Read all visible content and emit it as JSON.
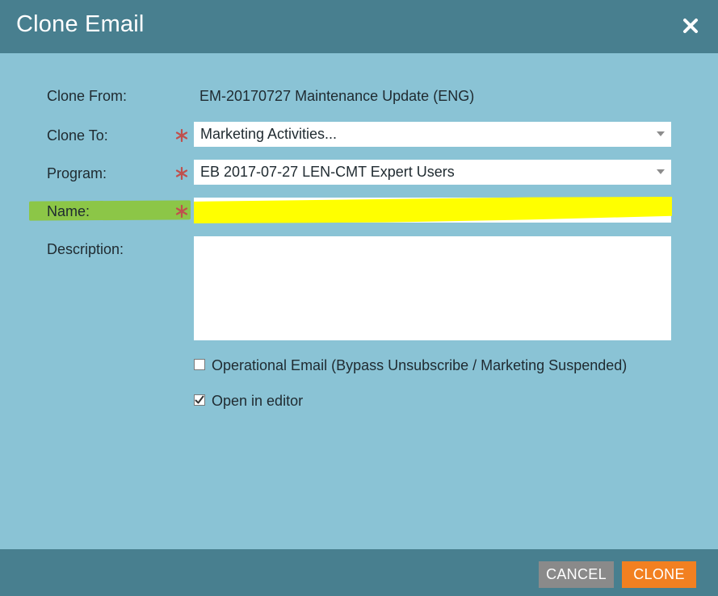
{
  "dialog": {
    "title": "Clone Email",
    "close_icon": "close-icon"
  },
  "form": {
    "clone_from": {
      "label": "Clone From:",
      "value": "EM-20170727 Maintenance Update (ENG)"
    },
    "clone_to": {
      "label": "Clone To:",
      "value": "Marketing Activities...",
      "required": true
    },
    "program": {
      "label": "Program:",
      "value": "EB 2017-07-27 LEN-CMT Expert Users",
      "required": true
    },
    "name": {
      "label": "Name:",
      "value": "",
      "required": true
    },
    "description": {
      "label": "Description:",
      "value": ""
    },
    "operational_email": {
      "label": "Operational Email (Bypass Unsubscribe / Marketing Suspended)",
      "checked": false
    },
    "open_in_editor": {
      "label": "Open in editor",
      "checked": true
    }
  },
  "footer": {
    "cancel_label": "CANCEL",
    "clone_label": "CLONE"
  },
  "colors": {
    "title_bar": "#487f8f",
    "body": "#8ac3d5",
    "required_star": "#c0504d",
    "clone_button": "#f28021",
    "cancel_button": "#8a8a8a",
    "highlight_green": "#8cc63f",
    "highlight_yellow": "#ffff00"
  }
}
